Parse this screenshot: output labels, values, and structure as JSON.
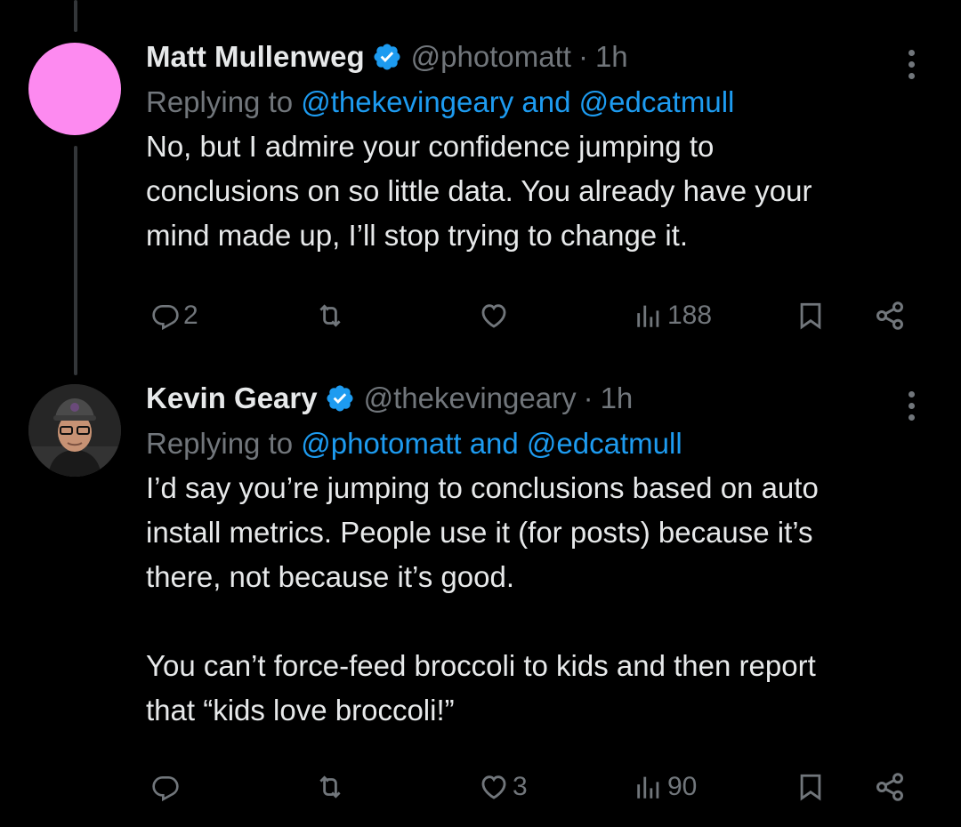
{
  "tweets": [
    {
      "name": "Matt Mullenweg",
      "handle": "@photomatt",
      "separator": "·",
      "time": "1h",
      "replying_prefix": "Replying to ",
      "replying_to": "@thekevingeary and @edcatmull",
      "body": [
        "No, but I admire your confidence jumping to",
        "conclusions on so little data. You already have your",
        "mind made up, I’ll stop trying to change it."
      ],
      "replies": "2",
      "retweets": "",
      "likes": "",
      "views": "188",
      "avatar_color": "#fd8af0"
    },
    {
      "name": "Kevin Geary",
      "handle": "@thekevingeary",
      "separator": "·",
      "time": "1h",
      "replying_prefix": "Replying to ",
      "replying_to": "@photomatt and @edcatmull",
      "body": [
        "I’d say you’re jumping to conclusions based on auto",
        "install metrics. People use it (for posts) because it’s",
        "there, not because it’s good.",
        "",
        "You can’t force-feed broccoli to kids and then report",
        "that “kids love broccoli!”"
      ],
      "replies": "",
      "retweets": "",
      "likes": "3",
      "views": "90"
    }
  ],
  "colors": {
    "background": "#000000",
    "text": "#e7e9ea",
    "muted": "#71767b",
    "link": "#1d9bf0",
    "verified": "#1d9bf0"
  },
  "icons": [
    "reply-icon",
    "retweet-icon",
    "like-icon",
    "views-icon",
    "bookmark-icon",
    "share-icon",
    "more-icon",
    "verified-badge-icon"
  ]
}
